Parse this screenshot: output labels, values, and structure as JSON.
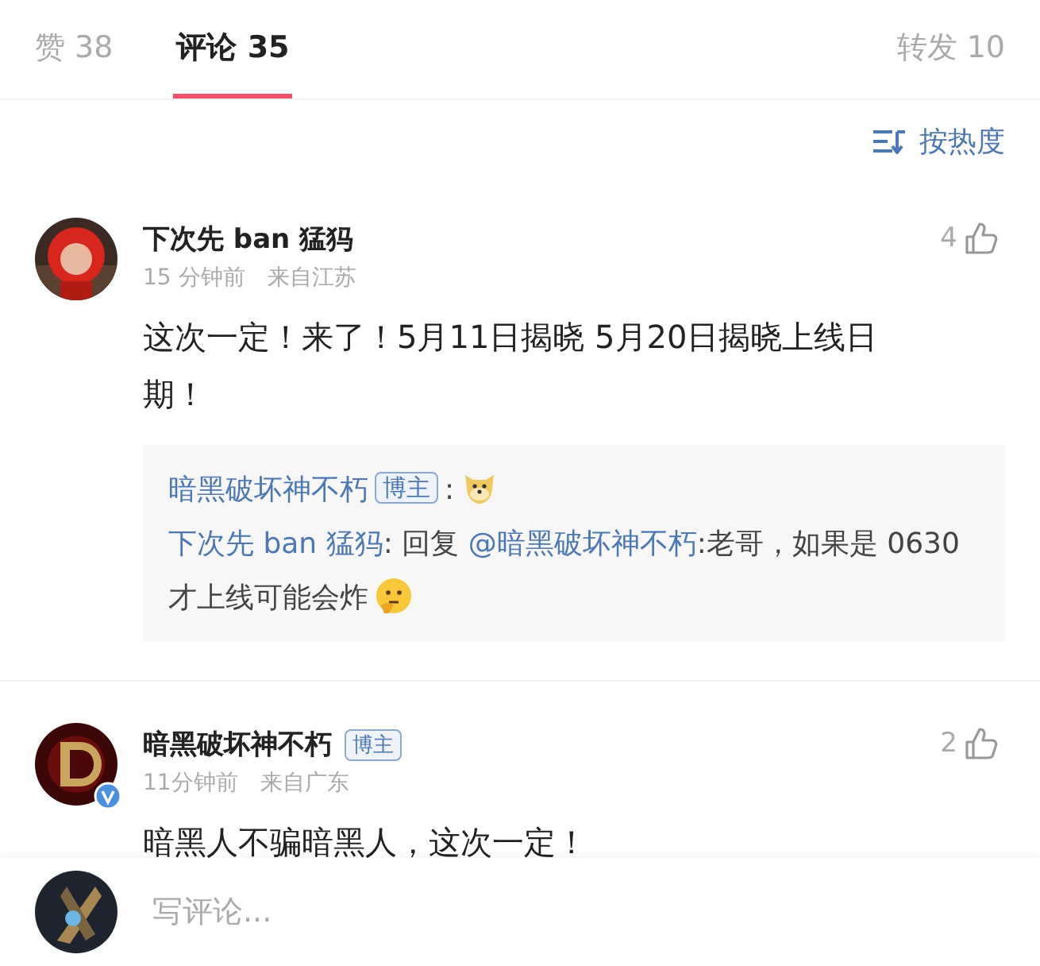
{
  "tabs": [
    {
      "label": "赞 38",
      "selected": false
    },
    {
      "label": "评论 35",
      "selected": true
    },
    {
      "label": "转发 10",
      "selected": false
    }
  ],
  "sort": {
    "label": "按热度"
  },
  "comments": [
    {
      "user": "下次先 ban 猛犸",
      "verified": false,
      "time": "15 分钟前",
      "location": "来自江苏",
      "likes": "4",
      "text": "这次一定！来了！5月11日揭晓 5月20日揭晓上线日期！",
      "replies": [
        {
          "author": "暗黑破坏神不朽",
          "badge": "博主",
          "parts": [
            {
              "kind": "text",
              "text": ":"
            },
            {
              "kind": "dog"
            }
          ]
        },
        {
          "author": "下次先 ban 猛犸",
          "parts": [
            {
              "kind": "text",
              "text": ": 回复 "
            },
            {
              "kind": "mention",
              "text": "@暗黑破坏神不朽"
            },
            {
              "kind": "text",
              "text": ":老哥，如果是 0630 才上线可能会炸"
            },
            {
              "kind": "thinking"
            }
          ]
        }
      ]
    },
    {
      "user": "暗黑破坏神不朽",
      "badge": "博主",
      "verified": true,
      "time": "11分钟前",
      "location": "来自广东",
      "likes": "2",
      "text": "暗黑人不骗暗黑人，这次一定！"
    }
  ],
  "composer": {
    "placeholder": "写评论..."
  }
}
